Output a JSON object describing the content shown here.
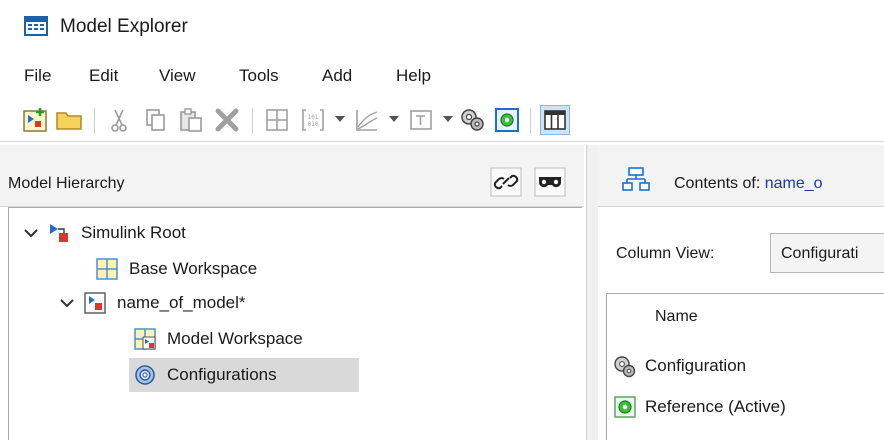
{
  "window": {
    "title": "Model Explorer"
  },
  "menu": {
    "file": "File",
    "edit": "Edit",
    "view": "View",
    "tools": "Tools",
    "add": "Add",
    "help": "Help"
  },
  "toolbar": {
    "icons": [
      "new-model-icon",
      "open-folder-icon",
      "cut-icon",
      "copy-icon",
      "paste-icon",
      "delete-icon",
      "grid-icon",
      "data-icon",
      "chart-icon",
      "block-icon",
      "config-icon",
      "reference-config-icon",
      "column-view-icon"
    ]
  },
  "hierarchy": {
    "header": "Model Hierarchy",
    "items": [
      {
        "label": "Simulink Root",
        "icon": "simulink-root-icon",
        "expanded": true
      },
      {
        "label": "Base Workspace",
        "icon": "workspace-icon"
      },
      {
        "label": "name_of_model*",
        "icon": "model-icon",
        "expanded": true
      },
      {
        "label": "Model Workspace",
        "icon": "model-workspace-icon"
      },
      {
        "label": "Configurations",
        "icon": "configurations-icon",
        "selected": true
      }
    ]
  },
  "contents": {
    "label": "Contents of:",
    "value": "name_o"
  },
  "column_view": {
    "label": "Column View:",
    "value": "Configurati"
  },
  "list": {
    "header": "Name",
    "rows": [
      {
        "label": "Configuration",
        "icon": "configuration-gear-icon"
      },
      {
        "label": "Reference (Active)",
        "icon": "reference-active-icon"
      }
    ]
  },
  "colors": {
    "selection": "#d9d9d9",
    "link": "#1a3aa8",
    "accent_blue": "#1f6fd1",
    "accent_red": "#d43a2a"
  }
}
